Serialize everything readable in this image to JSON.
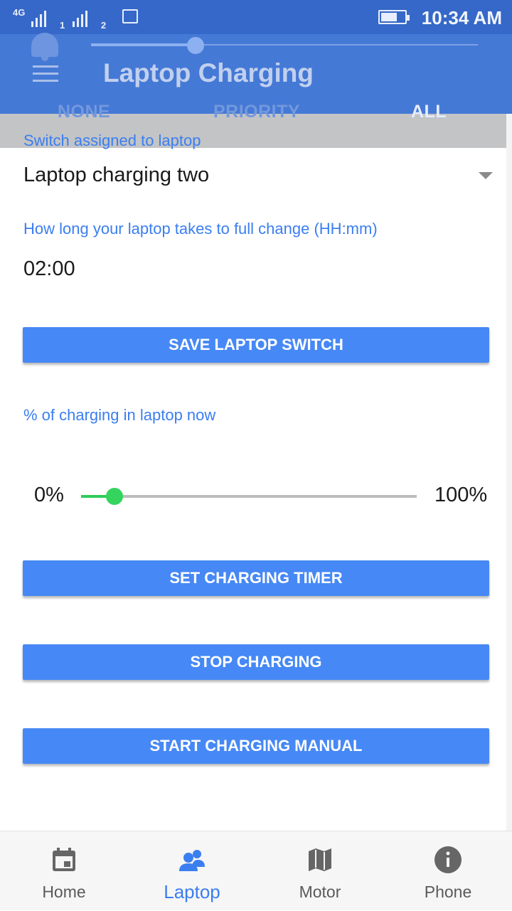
{
  "status_bar": {
    "network": "4G",
    "sim1": "1",
    "sim2": "2",
    "time": "10:34 AM"
  },
  "header": {
    "title": "Laptop Charging",
    "notification_tabs": [
      "NONE",
      "PRIORITY",
      "ALL"
    ],
    "notification_volume_fraction": 0.27
  },
  "form": {
    "switch_label": "Switch assigned to laptop",
    "switch_value": "Laptop charging two",
    "duration_label": "How long your laptop takes to full change (HH:mm)",
    "duration_value": "02:00",
    "save_button": "SAVE LAPTOP SWITCH",
    "charge_label": "% of charging in laptop now",
    "min_label": "0%",
    "max_label": "100%",
    "charge_level_fraction": 0.1,
    "timer_button": "SET CHARGING TIMER",
    "stop_button": "STOP CHARGING",
    "manual_button": "START CHARGING MANUAL"
  },
  "bottom_nav": {
    "items": [
      {
        "label": "Home",
        "icon": "calendar-icon"
      },
      {
        "label": "Laptop",
        "icon": "people-icon",
        "active": true
      },
      {
        "label": "Motor",
        "icon": "map-icon"
      },
      {
        "label": "Phone",
        "icon": "info-icon"
      }
    ]
  },
  "colors": {
    "accent": "#4688f5",
    "header": "#3d74d4",
    "slider": "#34d45e"
  }
}
